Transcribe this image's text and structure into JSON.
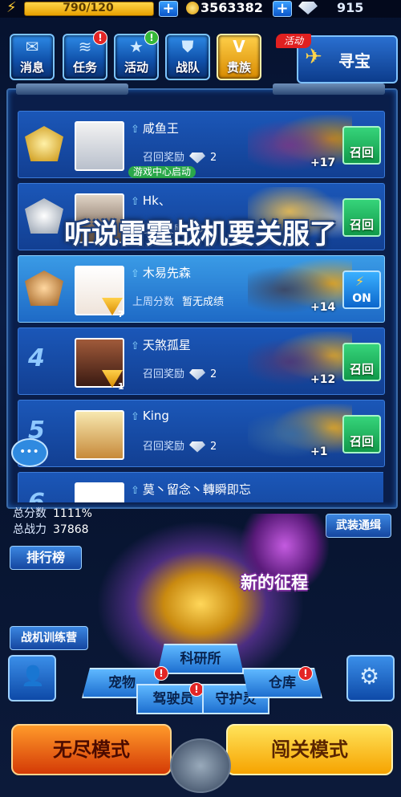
{
  "topbar": {
    "energy": "790/120",
    "gold": "3563382",
    "gems": "915"
  },
  "menu": [
    {
      "label": "消息",
      "icon": "mail-icon"
    },
    {
      "label": "任务",
      "icon": "task-icon",
      "badge": "!"
    },
    {
      "label": "活动",
      "icon": "event-icon",
      "badge": "!"
    },
    {
      "label": "战队",
      "icon": "team-icon"
    },
    {
      "label": "贵族",
      "icon": "vip-icon"
    }
  ],
  "treasure": {
    "label": "寻宝",
    "tag": "活动"
  },
  "overlay_caption": "听说雷霆战机要关服了",
  "ranking": [
    {
      "rank": "1",
      "name": "咸鱼王",
      "reward_label": "召回奖励",
      "reward_count": "2",
      "tag": "游戏中心启动",
      "plus": "+17",
      "button": "召回"
    },
    {
      "rank": "2",
      "name": "Hk、",
      "reward_label": "召回奖励",
      "reward_count": "2",
      "button": "召回"
    },
    {
      "rank": "3",
      "name": "木易先森",
      "reward_label": "上周分数",
      "reward_value": "暂无成绩",
      "plus": "+14",
      "vip": "7",
      "button": "ON"
    },
    {
      "rank": "4",
      "name": "天煞孤星",
      "reward_label": "召回奖励",
      "reward_count": "2",
      "plus": "+12",
      "vip": "1",
      "button": "召回"
    },
    {
      "rank": "5",
      "name": "King",
      "reward_label": "召回奖励",
      "reward_count": "2",
      "plus": "+1",
      "button": "召回"
    },
    {
      "rank": "6",
      "name": "莫丶留念丶轉瞬即忘"
    }
  ],
  "stats": {
    "score_label": "总分数",
    "score_value": "1111%",
    "power_label": "总战力",
    "power_value": "37868"
  },
  "buttons": {
    "leaderboard": "排行榜",
    "armament": "武装通缉",
    "new_journey": "新的征程",
    "training": "战机训练营",
    "research": "科研所",
    "pet": "宠物",
    "driver": "驾驶员",
    "guardian": "守护灵",
    "warehouse": "仓库",
    "endless": "无尽模式",
    "stage": "闯关模式"
  },
  "colors": {
    "accent": "#2d8ae6",
    "recall_green": "#36d47a",
    "alert_red": "#e32525",
    "gold": "#ffd54a"
  }
}
